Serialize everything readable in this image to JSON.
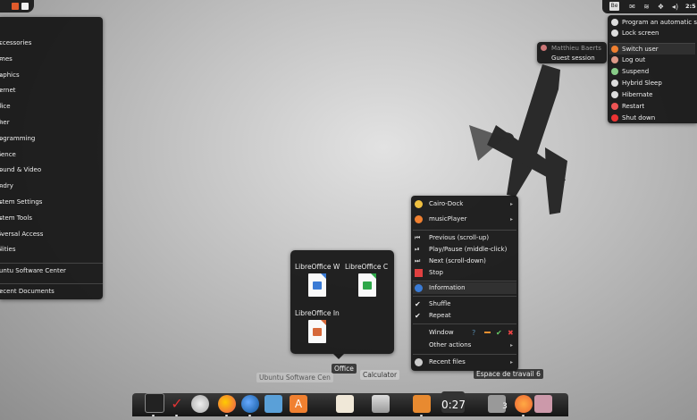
{
  "apps_menu": {
    "items": [
      {
        "label": "ccessories",
        "submenu": true
      },
      {
        "label": "mes",
        "submenu": true
      },
      {
        "label": "aphics",
        "submenu": true
      },
      {
        "label": "ernet",
        "submenu": true
      },
      {
        "label": "fice",
        "submenu": true
      },
      {
        "label": "her",
        "submenu": true
      },
      {
        "label": "ogramming",
        "submenu": true
      },
      {
        "label": "ience",
        "submenu": true
      },
      {
        "label": "ound & Video",
        "submenu": true
      },
      {
        "label": "ndry",
        "submenu": true
      },
      {
        "label": "stem Settings",
        "submenu": true
      },
      {
        "label": "stem Tools",
        "submenu": true
      },
      {
        "label": "iversal Access",
        "submenu": true
      },
      {
        "label": "ilities",
        "submenu": true
      }
    ],
    "software_center": "untu Software Center",
    "recent_documents": "ecent Documents"
  },
  "top_panel": {
    "be_label": "Be",
    "clock": "2:5"
  },
  "session_menu": {
    "items": [
      {
        "label": "Program an automatic shut-dow",
        "icon": "clock-icon"
      },
      {
        "label": "Lock screen",
        "icon": "lock-icon"
      },
      {
        "label": "Switch user",
        "icon": "switch-user-icon"
      },
      {
        "label": "Log out",
        "icon": "logout-icon"
      },
      {
        "label": "Suspend",
        "icon": "suspend-icon"
      },
      {
        "label": "Hybrid Sleep",
        "icon": "hybrid-sleep-icon"
      },
      {
        "label": "Hibernate",
        "icon": "hibernate-icon"
      },
      {
        "label": "Restart",
        "icon": "restart-icon"
      },
      {
        "label": "Shut down",
        "icon": "shutdown-icon"
      }
    ]
  },
  "user_popup": {
    "user_name": "Matthieu Baerts",
    "guest": "Guest session"
  },
  "dock_menu": {
    "cairo_dock": "Cairo-Dock",
    "music_player": "musicPlayer",
    "previous": "Previous (scroll-up)",
    "play_pause": "Play/Pause (middle-click)",
    "next": "Next (scroll-down)",
    "stop": "Stop",
    "information": "Information",
    "shuffle": "Shuffle",
    "repeat": "Repeat",
    "window": "Window",
    "other_actions": "Other actions",
    "recent_files": "Recent files"
  },
  "office_popup": {
    "apps": [
      {
        "label": "LibreOffice W",
        "color": "#3a7bd5"
      },
      {
        "label": "LibreOffice C",
        "color": "#2fa84a"
      },
      {
        "label": "LibreOffice In",
        "color": "#d6693a"
      }
    ]
  },
  "dock_labels": {
    "office": "Office",
    "calculator": "Calculator",
    "software_center": "Ubuntu Software Cen",
    "workspace": "Espace de travail 6",
    "timer": "0:27",
    "badge": "3"
  }
}
